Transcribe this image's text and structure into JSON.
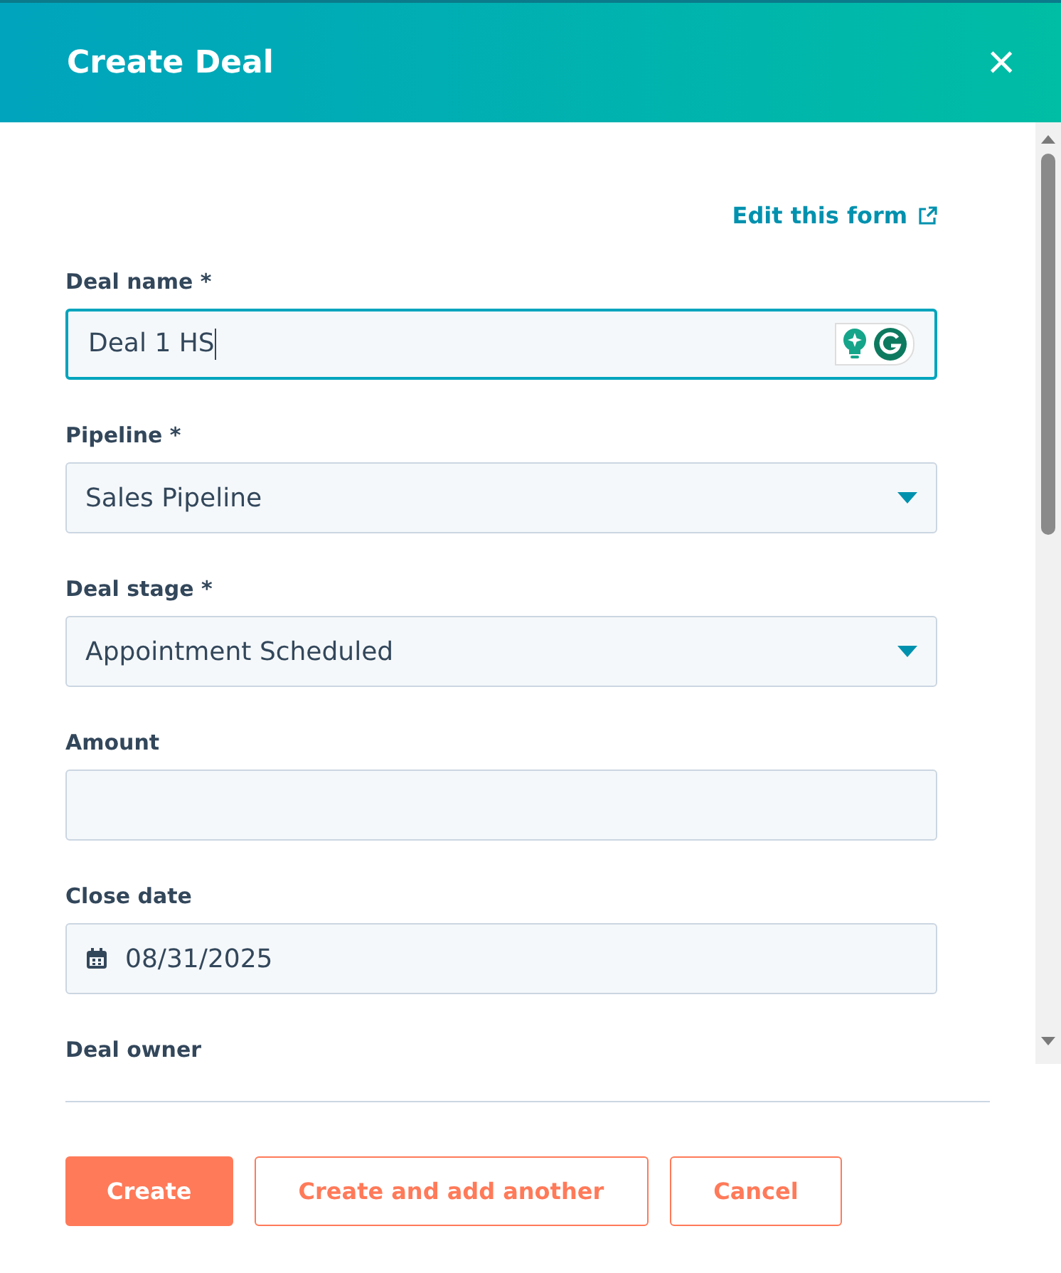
{
  "dialog": {
    "title": "Create Deal",
    "close_icon": "×"
  },
  "edit_link": {
    "label": "Edit this form"
  },
  "fields": [
    {
      "label": "Deal name *",
      "kind": "text",
      "value": "Deal 1 HS",
      "focused": true
    },
    {
      "label": "Pipeline *",
      "kind": "select",
      "value": "Sales Pipeline",
      "focused": false
    },
    {
      "label": "Deal stage *",
      "kind": "select",
      "value": "Appointment Scheduled",
      "focused": false
    },
    {
      "label": "Amount",
      "kind": "text",
      "focused": false
    },
    {
      "label": "Close date",
      "kind": "date",
      "value": "08/31/2025",
      "focused": false
    },
    {
      "label": "Deal owner",
      "kind": "label_only"
    }
  ],
  "buttons": [
    {
      "label": "Create",
      "kind": "primary"
    },
    {
      "label": "Create and add another",
      "kind": "secondary"
    },
    {
      "label": "Cancel",
      "kind": "secondary"
    }
  ]
}
